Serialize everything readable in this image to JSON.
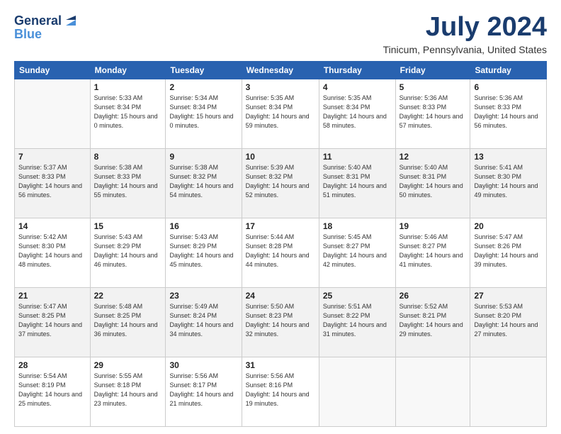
{
  "logo": {
    "general": "General",
    "blue": "Blue"
  },
  "title": "July 2024",
  "location": "Tinicum, Pennsylvania, United States",
  "weekdays": [
    "Sunday",
    "Monday",
    "Tuesday",
    "Wednesday",
    "Thursday",
    "Friday",
    "Saturday"
  ],
  "weeks": [
    [
      {
        "day": "",
        "sunrise": "",
        "sunset": "",
        "daylight": "",
        "empty": true
      },
      {
        "day": "1",
        "sunrise": "Sunrise: 5:33 AM",
        "sunset": "Sunset: 8:34 PM",
        "daylight": "Daylight: 15 hours and 0 minutes."
      },
      {
        "day": "2",
        "sunrise": "Sunrise: 5:34 AM",
        "sunset": "Sunset: 8:34 PM",
        "daylight": "Daylight: 15 hours and 0 minutes."
      },
      {
        "day": "3",
        "sunrise": "Sunrise: 5:35 AM",
        "sunset": "Sunset: 8:34 PM",
        "daylight": "Daylight: 14 hours and 59 minutes."
      },
      {
        "day": "4",
        "sunrise": "Sunrise: 5:35 AM",
        "sunset": "Sunset: 8:34 PM",
        "daylight": "Daylight: 14 hours and 58 minutes."
      },
      {
        "day": "5",
        "sunrise": "Sunrise: 5:36 AM",
        "sunset": "Sunset: 8:33 PM",
        "daylight": "Daylight: 14 hours and 57 minutes."
      },
      {
        "day": "6",
        "sunrise": "Sunrise: 5:36 AM",
        "sunset": "Sunset: 8:33 PM",
        "daylight": "Daylight: 14 hours and 56 minutes."
      }
    ],
    [
      {
        "day": "7",
        "sunrise": "Sunrise: 5:37 AM",
        "sunset": "Sunset: 8:33 PM",
        "daylight": "Daylight: 14 hours and 56 minutes."
      },
      {
        "day": "8",
        "sunrise": "Sunrise: 5:38 AM",
        "sunset": "Sunset: 8:33 PM",
        "daylight": "Daylight: 14 hours and 55 minutes."
      },
      {
        "day": "9",
        "sunrise": "Sunrise: 5:38 AM",
        "sunset": "Sunset: 8:32 PM",
        "daylight": "Daylight: 14 hours and 54 minutes."
      },
      {
        "day": "10",
        "sunrise": "Sunrise: 5:39 AM",
        "sunset": "Sunset: 8:32 PM",
        "daylight": "Daylight: 14 hours and 52 minutes."
      },
      {
        "day": "11",
        "sunrise": "Sunrise: 5:40 AM",
        "sunset": "Sunset: 8:31 PM",
        "daylight": "Daylight: 14 hours and 51 minutes."
      },
      {
        "day": "12",
        "sunrise": "Sunrise: 5:40 AM",
        "sunset": "Sunset: 8:31 PM",
        "daylight": "Daylight: 14 hours and 50 minutes."
      },
      {
        "day": "13",
        "sunrise": "Sunrise: 5:41 AM",
        "sunset": "Sunset: 8:30 PM",
        "daylight": "Daylight: 14 hours and 49 minutes."
      }
    ],
    [
      {
        "day": "14",
        "sunrise": "Sunrise: 5:42 AM",
        "sunset": "Sunset: 8:30 PM",
        "daylight": "Daylight: 14 hours and 48 minutes."
      },
      {
        "day": "15",
        "sunrise": "Sunrise: 5:43 AM",
        "sunset": "Sunset: 8:29 PM",
        "daylight": "Daylight: 14 hours and 46 minutes."
      },
      {
        "day": "16",
        "sunrise": "Sunrise: 5:43 AM",
        "sunset": "Sunset: 8:29 PM",
        "daylight": "Daylight: 14 hours and 45 minutes."
      },
      {
        "day": "17",
        "sunrise": "Sunrise: 5:44 AM",
        "sunset": "Sunset: 8:28 PM",
        "daylight": "Daylight: 14 hours and 44 minutes."
      },
      {
        "day": "18",
        "sunrise": "Sunrise: 5:45 AM",
        "sunset": "Sunset: 8:27 PM",
        "daylight": "Daylight: 14 hours and 42 minutes."
      },
      {
        "day": "19",
        "sunrise": "Sunrise: 5:46 AM",
        "sunset": "Sunset: 8:27 PM",
        "daylight": "Daylight: 14 hours and 41 minutes."
      },
      {
        "day": "20",
        "sunrise": "Sunrise: 5:47 AM",
        "sunset": "Sunset: 8:26 PM",
        "daylight": "Daylight: 14 hours and 39 minutes."
      }
    ],
    [
      {
        "day": "21",
        "sunrise": "Sunrise: 5:47 AM",
        "sunset": "Sunset: 8:25 PM",
        "daylight": "Daylight: 14 hours and 37 minutes."
      },
      {
        "day": "22",
        "sunrise": "Sunrise: 5:48 AM",
        "sunset": "Sunset: 8:25 PM",
        "daylight": "Daylight: 14 hours and 36 minutes."
      },
      {
        "day": "23",
        "sunrise": "Sunrise: 5:49 AM",
        "sunset": "Sunset: 8:24 PM",
        "daylight": "Daylight: 14 hours and 34 minutes."
      },
      {
        "day": "24",
        "sunrise": "Sunrise: 5:50 AM",
        "sunset": "Sunset: 8:23 PM",
        "daylight": "Daylight: 14 hours and 32 minutes."
      },
      {
        "day": "25",
        "sunrise": "Sunrise: 5:51 AM",
        "sunset": "Sunset: 8:22 PM",
        "daylight": "Daylight: 14 hours and 31 minutes."
      },
      {
        "day": "26",
        "sunrise": "Sunrise: 5:52 AM",
        "sunset": "Sunset: 8:21 PM",
        "daylight": "Daylight: 14 hours and 29 minutes."
      },
      {
        "day": "27",
        "sunrise": "Sunrise: 5:53 AM",
        "sunset": "Sunset: 8:20 PM",
        "daylight": "Daylight: 14 hours and 27 minutes."
      }
    ],
    [
      {
        "day": "28",
        "sunrise": "Sunrise: 5:54 AM",
        "sunset": "Sunset: 8:19 PM",
        "daylight": "Daylight: 14 hours and 25 minutes."
      },
      {
        "day": "29",
        "sunrise": "Sunrise: 5:55 AM",
        "sunset": "Sunset: 8:18 PM",
        "daylight": "Daylight: 14 hours and 23 minutes."
      },
      {
        "day": "30",
        "sunrise": "Sunrise: 5:56 AM",
        "sunset": "Sunset: 8:17 PM",
        "daylight": "Daylight: 14 hours and 21 minutes."
      },
      {
        "day": "31",
        "sunrise": "Sunrise: 5:56 AM",
        "sunset": "Sunset: 8:16 PM",
        "daylight": "Daylight: 14 hours and 19 minutes."
      },
      {
        "day": "",
        "sunrise": "",
        "sunset": "",
        "daylight": "",
        "empty": true
      },
      {
        "day": "",
        "sunrise": "",
        "sunset": "",
        "daylight": "",
        "empty": true
      },
      {
        "day": "",
        "sunrise": "",
        "sunset": "",
        "daylight": "",
        "empty": true
      }
    ]
  ]
}
